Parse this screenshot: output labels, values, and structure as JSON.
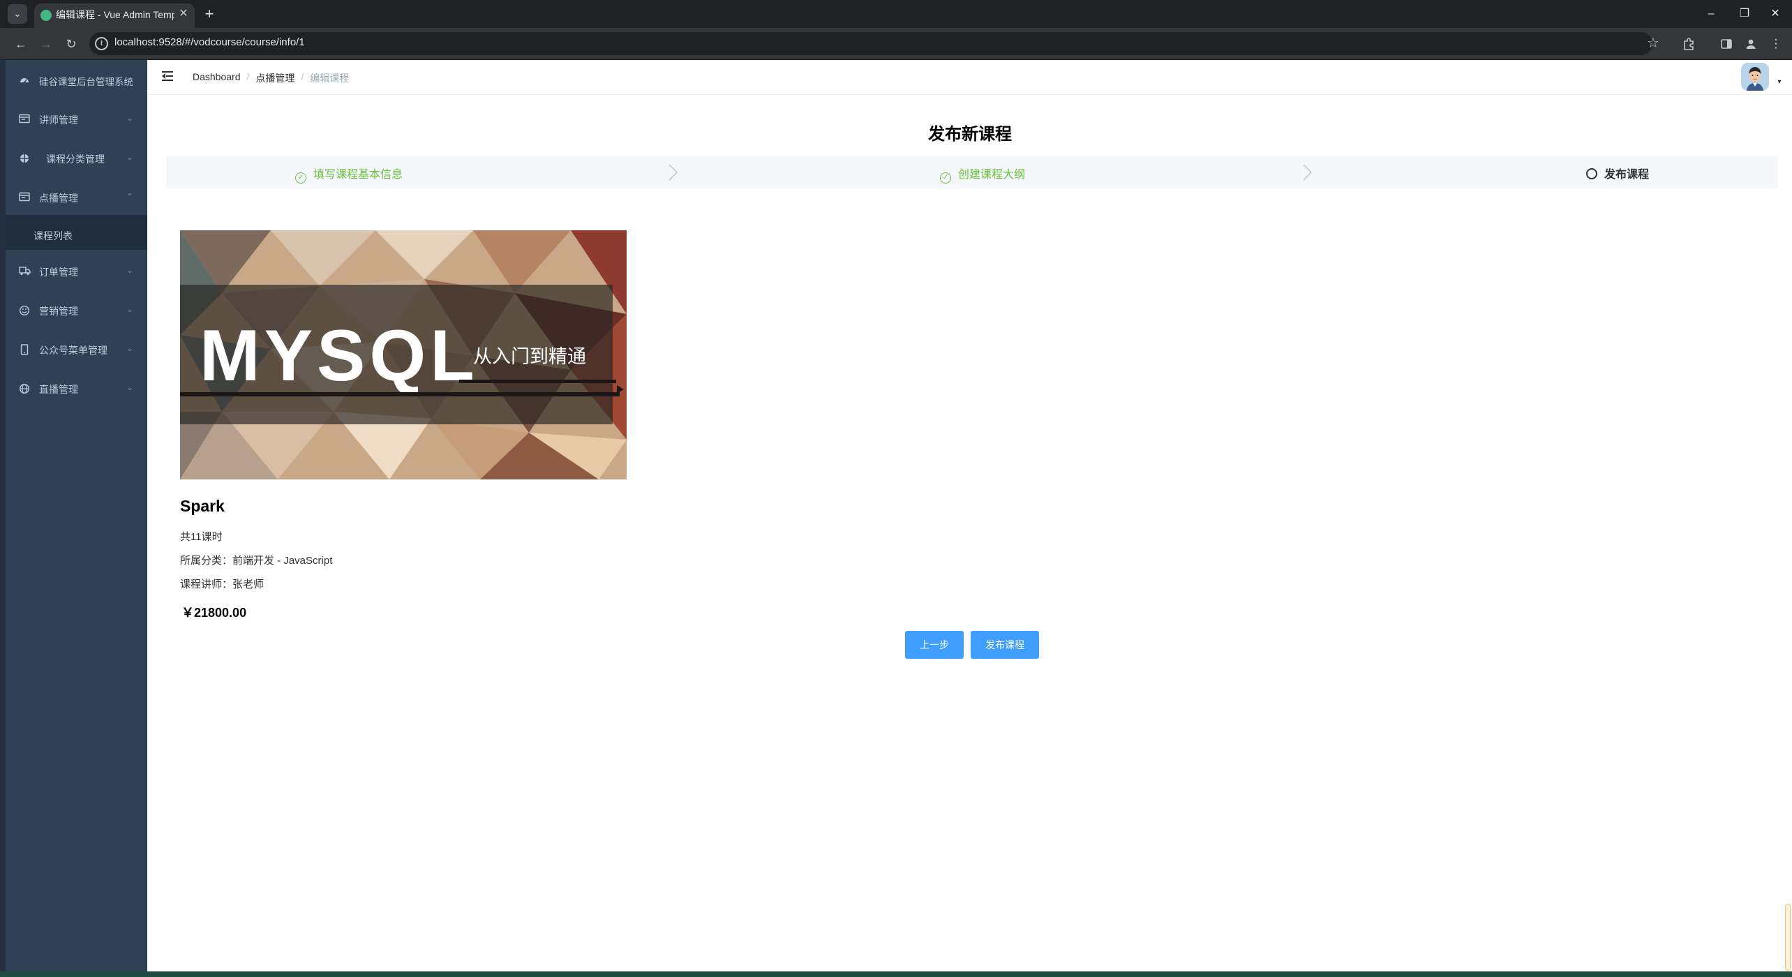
{
  "browser": {
    "tab_title": "编辑课程 - Vue Admin Template",
    "url": "localhost:9528/#/vodcourse/course/info/1",
    "tab_close_glyph": "✕",
    "tab_new_glyph": "+"
  },
  "sidebar": {
    "brand": "硅谷课堂后台管理系统",
    "items": [
      {
        "label": "讲师管理",
        "icon": "id-card-icon",
        "expanded": false
      },
      {
        "label": "课程分类管理",
        "icon": "category-icon",
        "expanded": false
      },
      {
        "label": "点播管理",
        "icon": "video-icon",
        "expanded": true
      },
      {
        "label": "订单管理",
        "icon": "truck-icon",
        "expanded": false
      },
      {
        "label": "营销管理",
        "icon": "smile-icon",
        "expanded": false
      },
      {
        "label": "公众号菜单管理",
        "icon": "phone-icon",
        "expanded": false
      },
      {
        "label": "直播管理",
        "icon": "globe-icon",
        "expanded": false
      }
    ],
    "subitem": "课程列表"
  },
  "breadcrumb": {
    "items": [
      "Dashboard",
      "点播管理",
      "编辑课程"
    ],
    "separator": "/"
  },
  "page": {
    "title": "发布新课程",
    "steps": [
      {
        "label": "填写课程基本信息",
        "status": "success"
      },
      {
        "label": "创建课程大纲",
        "status": "success"
      },
      {
        "label": "发布课程",
        "status": "process"
      }
    ]
  },
  "course": {
    "cover_main_text": "MYSQL",
    "cover_sub_text": "从入门到精通",
    "title": "Spark",
    "lessons": "共11课时",
    "category": "所属分类：前端开发 - JavaScript",
    "teacher": "课程讲师：张老师",
    "price": "￥21800.00"
  },
  "buttons": {
    "prev": "上一步",
    "publish": "发布课程"
  },
  "colors": {
    "sidebar_bg": "#304156",
    "sidebar_text": "#bfcbd9",
    "primary": "#409eff",
    "success": "#67c23a"
  }
}
